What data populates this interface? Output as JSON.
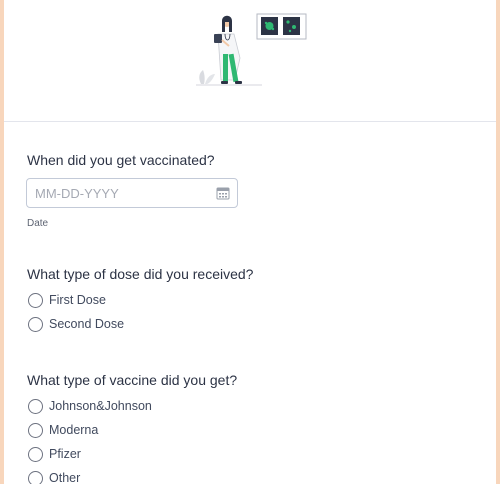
{
  "hero": {
    "illustration_icon": "doctor-with-clipboard-illustration",
    "accent_color": "#2fb872"
  },
  "form": {
    "q1": {
      "label": "When did you get vaccinated?",
      "date_placeholder": "MM-DD-YYYY",
      "date_value": "",
      "sublabel": "Date",
      "icon": "calendar-icon"
    },
    "q2": {
      "label": "What type of dose did you received?",
      "options": [
        "First Dose",
        "Second Dose"
      ]
    },
    "q3": {
      "label": "What type of vaccine did you get?",
      "options": [
        "Johnson&Johnson",
        "Moderna",
        "Pfizer",
        "Other"
      ]
    }
  },
  "colors": {
    "page_background": "#f8d6bc",
    "card_background": "#ffffff",
    "text": "#2c3345",
    "input_border": "#c3cad8"
  }
}
